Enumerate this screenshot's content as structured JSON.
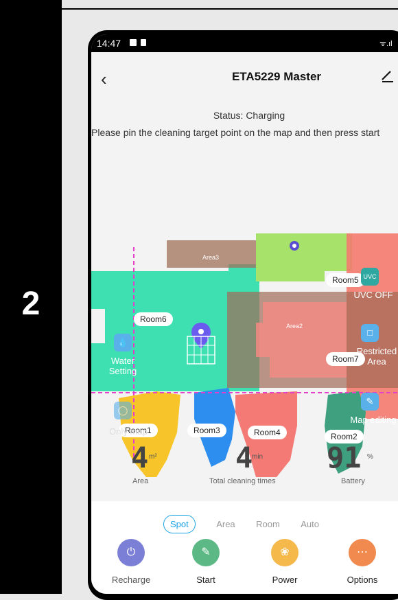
{
  "step_number": "2",
  "statusbar": {
    "time": "14:47",
    "signal": "ᯤ.ıl"
  },
  "header": {
    "title": "ETA5229 Master"
  },
  "status_text": "Status: Charging",
  "hint_text": "Please pin the cleaning target point on the map and then press start",
  "map": {
    "areas": [
      "Area3",
      "Area2"
    ],
    "rooms": [
      "Room6",
      "Room5",
      "Room7",
      "Room1",
      "Room3",
      "Room4",
      "Room2"
    ],
    "side_controls": {
      "water": "Water Setting",
      "uvc_icon": "UVC",
      "uvc_status": "UVC OFF",
      "restricted": "Restricted Area",
      "map_editing": "Map editing",
      "only_map": "Only map"
    }
  },
  "stats": {
    "area": {
      "value": "4",
      "unit": "m²",
      "label": "Area"
    },
    "time": {
      "value": "4",
      "unit": "min",
      "label": "Total cleaning times"
    },
    "battery": {
      "value": "91",
      "unit": "%",
      "label": "Battery"
    }
  },
  "tabs": [
    "Spot",
    "Area",
    "Room",
    "Auto"
  ],
  "actions": [
    {
      "label": "Recharge",
      "color": "#7b7fd6"
    },
    {
      "label": "Start",
      "color": "#5cb985"
    },
    {
      "label": "Power",
      "color": "#f5b84a"
    },
    {
      "label": "Options",
      "color": "#f08a4e"
    }
  ]
}
